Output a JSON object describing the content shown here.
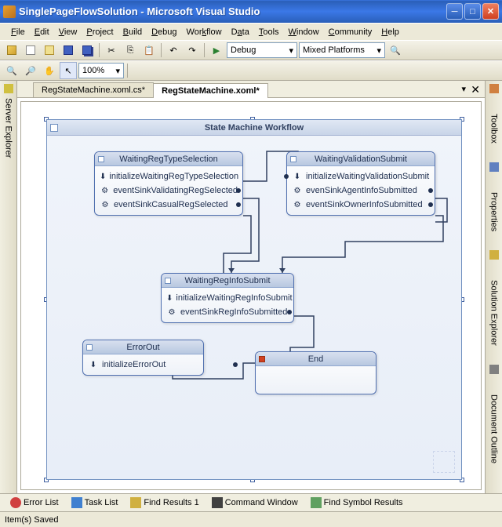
{
  "window": {
    "title": "SinglePageFlowSolution - Microsoft Visual Studio"
  },
  "menu": [
    "File",
    "Edit",
    "View",
    "Project",
    "Build",
    "Debug",
    "Workflow",
    "Data",
    "Tools",
    "Window",
    "Community",
    "Help"
  ],
  "toolbar": {
    "config": "Debug",
    "platform": "Mixed Platforms",
    "zoom": "100%"
  },
  "tabs": {
    "items": [
      {
        "label": "RegStateMachine.xoml.cs*",
        "active": false
      },
      {
        "label": "RegStateMachine.xoml*",
        "active": true
      }
    ]
  },
  "workflow": {
    "title": "State Machine Workflow",
    "states": {
      "waitingRegType": {
        "title": "WaitingRegTypeSelection",
        "activities": [
          "initializeWaitingRegTypeSelection",
          "eventSinkValidatingRegSelected",
          "eventSinkCasualRegSelected"
        ]
      },
      "waitingValidation": {
        "title": "WaitingValidationSubmit",
        "activities": [
          "initializeWaitingValidationSubmit",
          "evenSinkAgentInfoSubmitted",
          "eventSinkOwnerInfoSubmitted"
        ]
      },
      "waitingRegInfo": {
        "title": "WaitingRegInfoSubmit",
        "activities": [
          "initializeWaitingRegInfoSubmit",
          "eventSinkRegInfoSubmitted"
        ]
      },
      "errorOut": {
        "title": "ErrorOut",
        "activities": [
          "initializeErrorOut"
        ]
      },
      "end": {
        "title": "End"
      }
    }
  },
  "side": {
    "left": "Server Explorer",
    "right": [
      "Toolbox",
      "Properties",
      "Solution Explorer",
      "Document Outline"
    ]
  },
  "bottomTabs": [
    "Error List",
    "Task List",
    "Find Results 1",
    "Command Window",
    "Find Symbol Results"
  ],
  "status": "Item(s) Saved"
}
